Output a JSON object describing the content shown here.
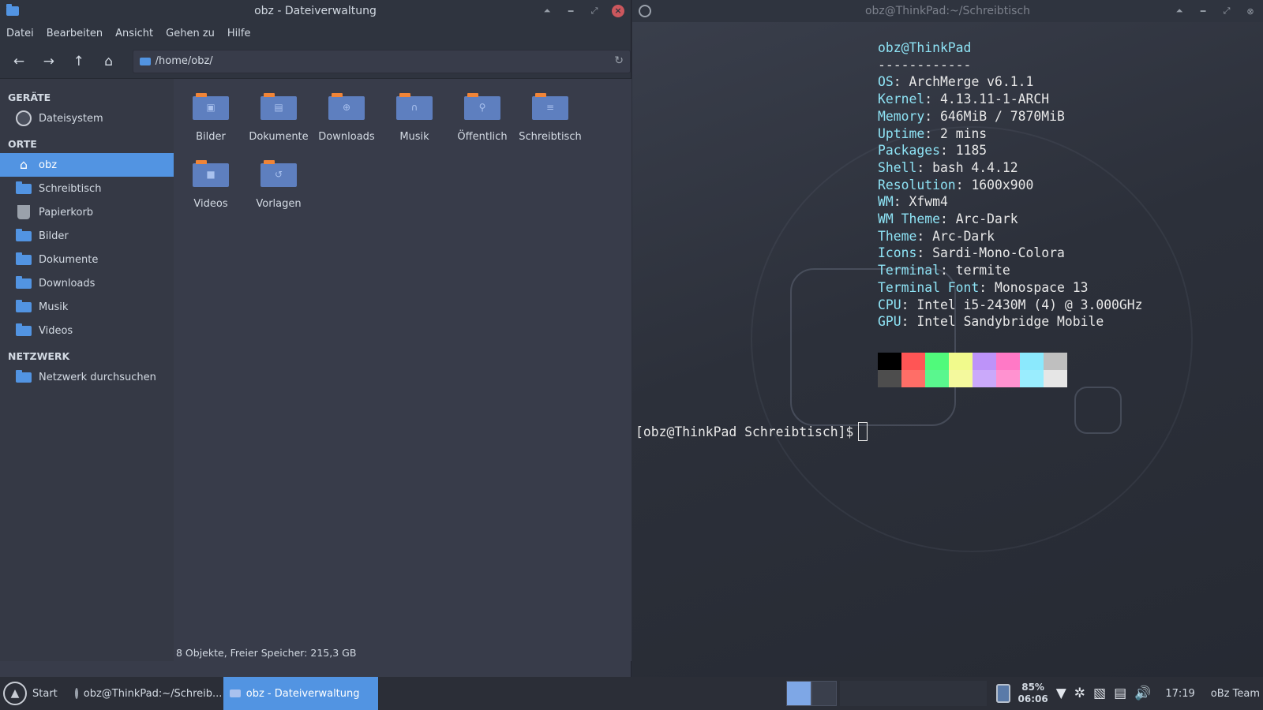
{
  "file_manager": {
    "title": "obz - Dateiverwaltung",
    "menu": [
      "Datei",
      "Bearbeiten",
      "Ansicht",
      "Gehen zu",
      "Hilfe"
    ],
    "path": "/home/obz/",
    "sidebar": {
      "devices_heading": "GERÄTE",
      "filesystem": "Dateisystem",
      "places_heading": "ORTE",
      "places": [
        "obz",
        "Schreibtisch",
        "Papierkorb",
        "Bilder",
        "Dokumente",
        "Downloads",
        "Musik",
        "Videos"
      ],
      "network_heading": "NETZWERK",
      "network_browse": "Netzwerk durchsuchen"
    },
    "files": [
      "Bilder",
      "Dokumente",
      "Downloads",
      "Musik",
      "Öffentlich",
      "Schreibtisch",
      "Videos",
      "Vorlagen"
    ],
    "status": "8 Objekte, Freier Speicher: 215,3 GB"
  },
  "terminal": {
    "title": "obz@ThinkPad:~/Schreibtisch",
    "header": "obz@ThinkPad",
    "separator": "------------",
    "info": [
      {
        "key": "OS",
        "value": "ArchMerge v6.1.1"
      },
      {
        "key": "Kernel",
        "value": "4.13.11-1-ARCH"
      },
      {
        "key": "Memory",
        "value": "646MiB / 7870MiB"
      },
      {
        "key": "Uptime",
        "value": "2 mins"
      },
      {
        "key": "Packages",
        "value": "1185"
      },
      {
        "key": "Shell",
        "value": "bash 4.4.12"
      },
      {
        "key": "Resolution",
        "value": "1600x900"
      },
      {
        "key": "WM",
        "value": "Xfwm4"
      },
      {
        "key": "WM Theme",
        "value": "Arc-Dark"
      },
      {
        "key": "Theme",
        "value": "Arc-Dark"
      },
      {
        "key": "Icons",
        "value": "Sardi-Mono-Colora"
      },
      {
        "key": "Terminal",
        "value": "termite"
      },
      {
        "key": "Terminal Font",
        "value": "Monospace 13"
      },
      {
        "key": "CPU",
        "value": "Intel i5-2430M (4) @ 3.000GHz"
      },
      {
        "key": "GPU",
        "value": "Intel Sandybridge Mobile"
      }
    ],
    "colors_row1": [
      "#000000",
      "#ff5555",
      "#50fa7b",
      "#f1fa8c",
      "#bd93f9",
      "#ff79c6",
      "#8be9fd",
      "#bfbfbf"
    ],
    "colors_row2": [
      "#4d4d4d",
      "#ff6e67",
      "#5af78e",
      "#f4f99d",
      "#caa9fa",
      "#ff92d0",
      "#9aedfe",
      "#e6e6e6"
    ],
    "prompt": "[obz@ThinkPad Schreibtisch]$"
  },
  "taskbar": {
    "start_label": "Start",
    "tasks": [
      {
        "label": "obz@ThinkPad:~/Schreib...",
        "active": false
      },
      {
        "label": "obz - Dateiverwaltung",
        "active": true
      }
    ],
    "battery_percent": "85%",
    "battery_time": "06:06",
    "clock": "17:19",
    "user": "oBz Team"
  },
  "colors": {
    "accent": "#5294e2",
    "terminal_key": "#8ee3f5"
  }
}
